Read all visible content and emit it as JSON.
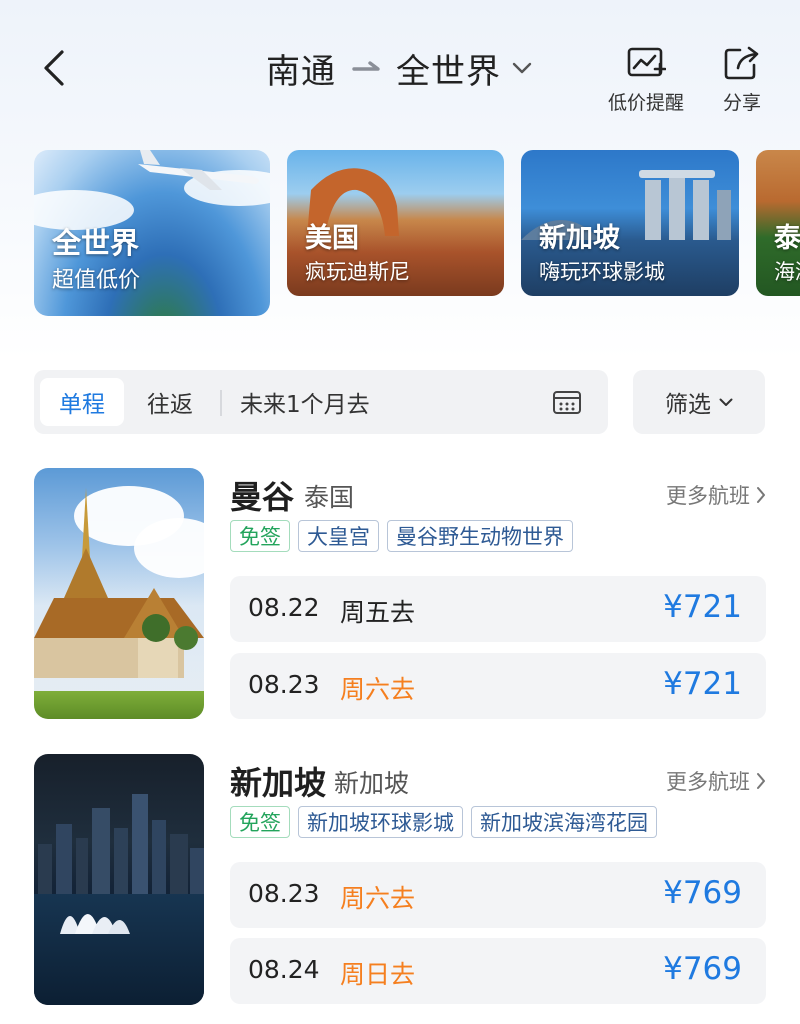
{
  "header": {
    "from_city": "南通",
    "to_city": "全世界",
    "price_alert_label": "低价提醒",
    "share_label": "分享"
  },
  "promos": [
    {
      "title": "全世界",
      "subtitle": "超值低价"
    },
    {
      "title": "美国",
      "subtitle": "疯玩迪斯尼"
    },
    {
      "title": "新加坡",
      "subtitle": "嗨玩环球影城"
    },
    {
      "title": "泰国",
      "subtitle": "海滩"
    }
  ],
  "filterbar": {
    "one_way": "单程",
    "round_trip": "往返",
    "date_range": "未来1个月去",
    "filter_label": "筛选"
  },
  "colors": {
    "accent": "#1f7ae0",
    "weekend": "#f57f1f",
    "visa_tag": "#23a45c"
  },
  "destinations": [
    {
      "name": "曼谷",
      "country": "泰国",
      "more_label": "更多航班",
      "tags": [
        "免签",
        "大皇宫",
        "曼谷野生动物世界"
      ],
      "flights": [
        {
          "date": "08.22",
          "weekday": "周五去",
          "weekend": false,
          "price": "¥721"
        },
        {
          "date": "08.23",
          "weekday": "周六去",
          "weekend": true,
          "price": "¥721"
        }
      ]
    },
    {
      "name": "新加坡",
      "country": "新加坡",
      "more_label": "更多航班",
      "tags": [
        "免签",
        "新加坡环球影城",
        "新加坡滨海湾花园"
      ],
      "flights": [
        {
          "date": "08.23",
          "weekday": "周六去",
          "weekend": true,
          "price": "¥769"
        },
        {
          "date": "08.24",
          "weekday": "周日去",
          "weekend": true,
          "price": "¥769"
        }
      ]
    }
  ]
}
